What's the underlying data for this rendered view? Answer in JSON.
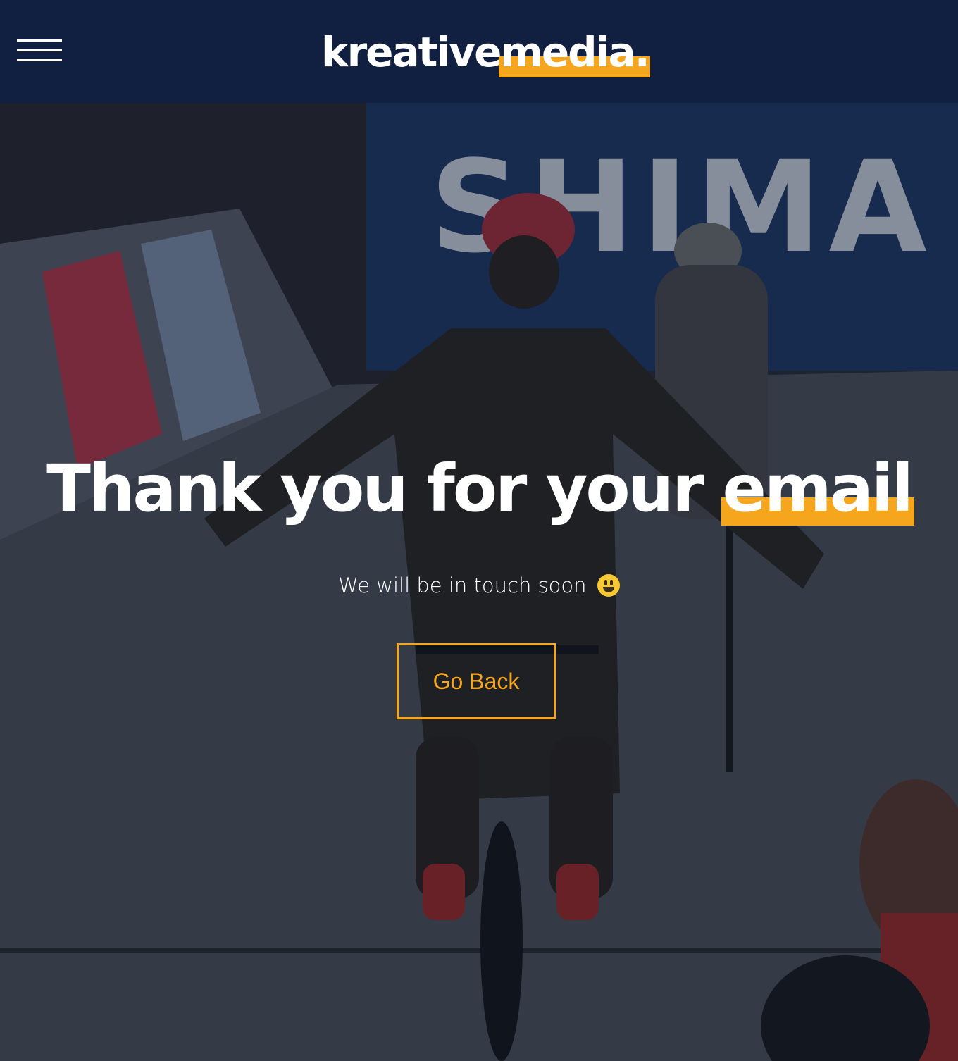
{
  "header": {
    "menu_icon": "hamburger-menu-icon",
    "logo_main": "kreative",
    "logo_accent": "media.",
    "background": "#112040",
    "accent_color": "#f5a61c"
  },
  "hero": {
    "headline_main": "Thank you for your ",
    "headline_accent": "email",
    "subline": "We will be in touch soon",
    "subline_emoji": "grinning-face-emoji",
    "button_label": "Go Back",
    "background_banner_text": "SHIMA"
  }
}
